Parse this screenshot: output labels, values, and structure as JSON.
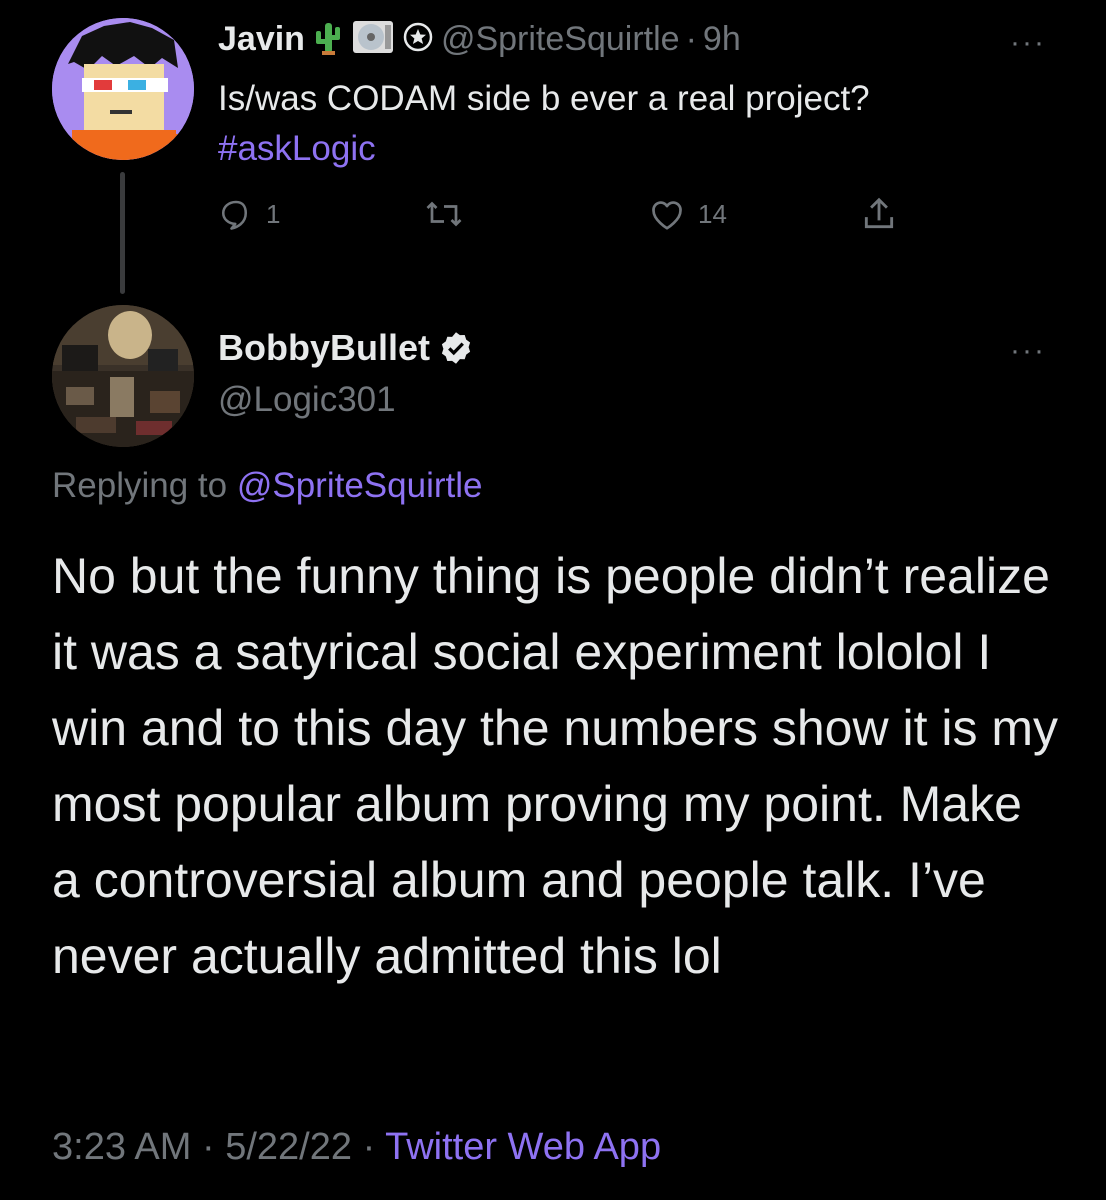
{
  "original_tweet": {
    "display_name": "Javin",
    "badge_icons": [
      "cactus-icon",
      "cd-icon",
      "star-badge-icon"
    ],
    "handle": "@SpriteSquirtle",
    "separator": "·",
    "time": "9h",
    "text": "Is/was CODAM side b ever a real project?",
    "hashtag": "#askLogic",
    "more_label": "···",
    "reply_count": "1",
    "retweet_count": "",
    "like_count": "14"
  },
  "reply_tweet": {
    "display_name": "BobbyBullet",
    "verified_icon": "verified-badge-icon",
    "handle": "@Logic301",
    "more_label": "···",
    "replying_to_label": "Replying to",
    "replying_to_handle": "@SpriteSquirtle",
    "body": "No but the funny thing is people didn’t realize it was a satyrical social experiment lololol I win and to this day the numbers show it is my most popular album proving my point. Make a controversial album and people talk. I’ve never actually admitted this lol",
    "time": "3:23 AM",
    "dot": "·",
    "date": "5/22/22",
    "app": "Twitter Web App"
  },
  "colors": {
    "background": "#000000",
    "text": "#e7e9ea",
    "muted": "#71767b",
    "link": "#8e72f2"
  }
}
